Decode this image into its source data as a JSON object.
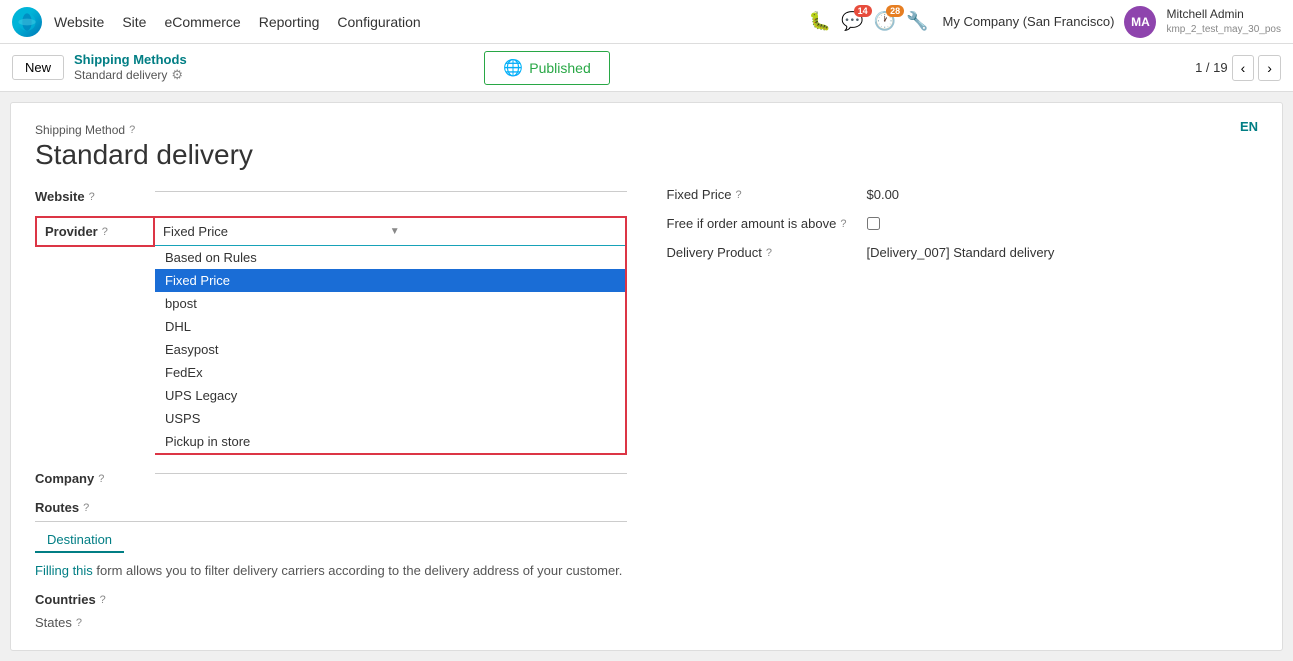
{
  "navbar": {
    "app_name": "Website",
    "menu_items": [
      "Site",
      "eCommerce",
      "Reporting",
      "Configuration"
    ],
    "bug_icon": "🐛",
    "chat_badge": "14",
    "clock_badge": "28",
    "wrench_icon": "🔧",
    "company": "My Company (San Francisco)",
    "user_name": "Mitchell Admin",
    "user_db": "kmp_2_test_may_30_pos"
  },
  "breadcrumb": {
    "new_label": "New",
    "parent_label": "Shipping Methods",
    "current_label": "Standard delivery",
    "published_label": "Published",
    "page_current": "1",
    "page_total": "19"
  },
  "form": {
    "shipping_method_label": "Shipping Method",
    "shipping_method_help": "?",
    "title": "Standard delivery",
    "en_label": "EN",
    "website_label": "Website",
    "website_help": "?",
    "website_value": "",
    "provider_label": "Provider",
    "provider_help": "?",
    "provider_value": "Fixed Price",
    "provider_options": [
      "Based on Rules",
      "Fixed Price",
      "bpost",
      "DHL",
      "Easypost",
      "FedEx",
      "UPS Legacy",
      "USPS",
      "Pickup in store"
    ],
    "company_label": "Company",
    "company_help": "?",
    "routes_label": "Routes",
    "routes_help": "?",
    "destination_tab": "Destination",
    "fill_notice_link": "Filling this",
    "fill_notice_text": " form allows you to filter delivery carriers according to the delivery address of your customer.",
    "countries_label": "Countries",
    "countries_help": "?",
    "states_label": "States",
    "states_help": "?",
    "fixed_price_label": "Fixed Price",
    "fixed_price_help": "?",
    "fixed_price_value": "$0.00",
    "free_if_label": "Free if order amount is above",
    "free_if_help": "?",
    "delivery_product_label": "Delivery Product",
    "delivery_product_help": "?",
    "delivery_product_value": "[Delivery_007] Standard delivery"
  }
}
